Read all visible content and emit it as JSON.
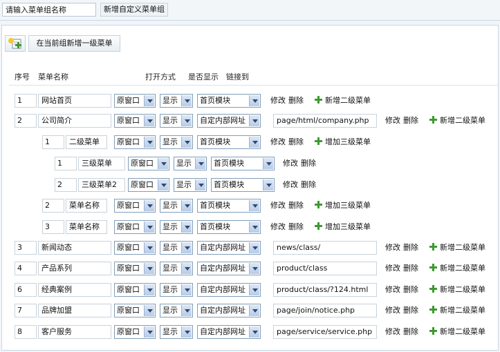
{
  "topbar": {
    "group_placeholder": "请输入菜单组名称",
    "add_group_btn": "新增自定义菜单组"
  },
  "add_level1_btn": "在当前组新增一级菜单",
  "headers": {
    "seq": "序号",
    "name": "菜单名称",
    "open": "打开方式",
    "show": "是否显示",
    "link": "链接到"
  },
  "actions": {
    "edit": "修改",
    "delete": "删除",
    "add_level2": "新增二级菜单",
    "add_level3": "增加三级菜单"
  },
  "rows": [
    {
      "level": 1,
      "num": "1",
      "name": "网站首页",
      "open": "原窗口",
      "show": "显示",
      "linkto": "首页模块",
      "url": "",
      "add": "add_level2"
    },
    {
      "level": 1,
      "num": "2",
      "name": "公司简介",
      "open": "原窗口",
      "show": "显示",
      "linkto": "自定内部网址",
      "url": "page/html/company.php",
      "add": "add_level2"
    },
    {
      "level": 2,
      "num": "1",
      "name": "二级菜单",
      "open": "原窗口",
      "show": "显示",
      "linkto": "首页模块",
      "url": "",
      "add": "add_level3"
    },
    {
      "level": 3,
      "num": "1",
      "name": "三级菜单",
      "open": "原窗口",
      "show": "显示",
      "linkto": "首页模块",
      "url": "",
      "add": ""
    },
    {
      "level": 3,
      "num": "2",
      "name": "三级菜单2",
      "open": "原窗口",
      "show": "显示",
      "linkto": "首页模块",
      "url": "",
      "add": ""
    },
    {
      "level": 2,
      "num": "2",
      "name": "菜单名称",
      "open": "原窗口",
      "show": "显示",
      "linkto": "首页模块",
      "url": "",
      "add": "add_level3"
    },
    {
      "level": 2,
      "num": "3",
      "name": "菜单名称",
      "open": "原窗口",
      "show": "显示",
      "linkto": "首页模块",
      "url": "",
      "add": "add_level3"
    },
    {
      "level": 1,
      "num": "3",
      "name": "新闻动态",
      "open": "原窗口",
      "show": "显示",
      "linkto": "自定内部网址",
      "url": "news/class/",
      "add": "add_level2"
    },
    {
      "level": 1,
      "num": "4",
      "name": "产品系列",
      "open": "原窗口",
      "show": "显示",
      "linkto": "自定内部网址",
      "url": "product/class",
      "add": "add_level2"
    },
    {
      "level": 1,
      "num": "6",
      "name": "经典案例",
      "open": "原窗口",
      "show": "显示",
      "linkto": "自定内部网址",
      "url": "product/class/?124.html",
      "add": "add_level2"
    },
    {
      "level": 1,
      "num": "7",
      "name": "品牌加盟",
      "open": "原窗口",
      "show": "显示",
      "linkto": "自定内部网址",
      "url": "page/join/notice.php",
      "add": "add_level2"
    },
    {
      "level": 1,
      "num": "8",
      "name": "客户服务",
      "open": "原窗口",
      "show": "显示",
      "linkto": "自定内部网址",
      "url": "page/service/service.php",
      "add": "add_level2"
    }
  ]
}
